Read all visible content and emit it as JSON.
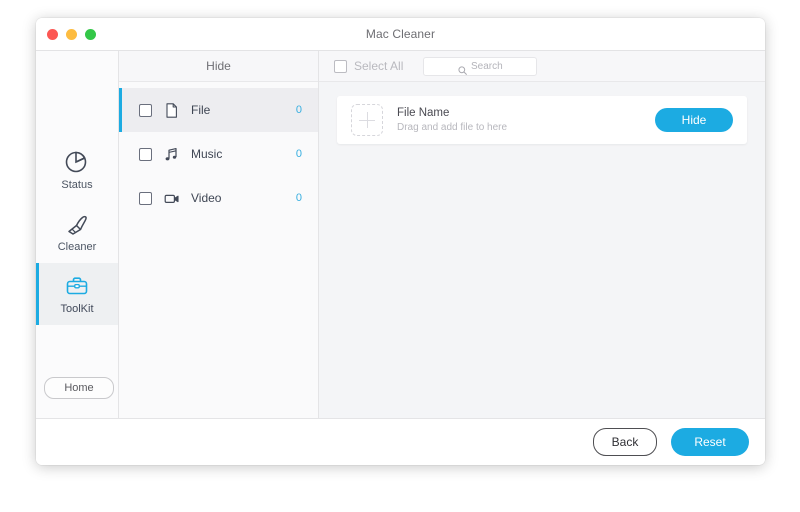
{
  "window": {
    "title": "Mac Cleaner",
    "traffic_lights": [
      {
        "name": "close",
        "color": "#fc5753"
      },
      {
        "name": "minimize",
        "color": "#fdbc40"
      },
      {
        "name": "maximize",
        "color": "#33c748"
      }
    ]
  },
  "theme": {
    "accent": "#1cabe2",
    "count_blue": "#37aee0",
    "panel_bg": "#f4f5f7",
    "sidebar_bg": "#fbfbfc"
  },
  "sidebar": {
    "items": [
      {
        "label": "Status",
        "icon": "pie-chart-icon",
        "active": false
      },
      {
        "label": "Cleaner",
        "icon": "brush-icon",
        "active": false
      },
      {
        "label": "ToolKit",
        "icon": "toolbox-icon",
        "active": true
      }
    ],
    "home_label": "Home"
  },
  "list_panel": {
    "header": "Hide",
    "categories": [
      {
        "label": "File",
        "icon": "file-icon",
        "count": "0",
        "checked": false,
        "selected": true
      },
      {
        "label": "Music",
        "icon": "music-note-icon",
        "count": "0",
        "checked": false,
        "selected": false
      },
      {
        "label": "Video",
        "icon": "video-camera-icon",
        "count": "0",
        "checked": false,
        "selected": false
      }
    ]
  },
  "main": {
    "toolbar": {
      "select_all_label": "Select All",
      "search_placeholder": "Search",
      "search_value": ""
    },
    "file_card": {
      "title": "File Name",
      "subtitle": "Drag and add file to here",
      "action_label": "Hide"
    }
  },
  "footer": {
    "back_label": "Back",
    "reset_label": "Reset"
  }
}
